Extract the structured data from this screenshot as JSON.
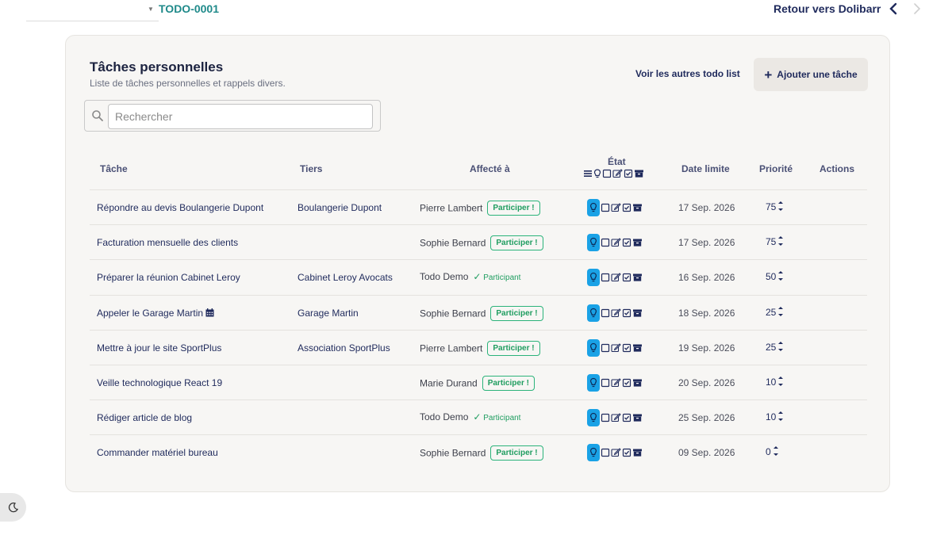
{
  "topbar": {
    "ref": "TODO-0001",
    "back_label": "Retour vers Dolibarr",
    "prev_icon": "chevron-left-icon",
    "next_icon": "chevron-right-icon"
  },
  "header": {
    "title": "Tâches personnelles",
    "subtitle": "Liste de tâches personnelles et rappels divers.",
    "other_lists": "Voir les autres todo list",
    "add_task": "Ajouter une tâche"
  },
  "search": {
    "placeholder": "Rechercher"
  },
  "table": {
    "columns": {
      "task": "Tâche",
      "tiers": "Tiers",
      "assigned": "Affecté à",
      "state": "État",
      "due": "Date limite",
      "priority": "Priorité",
      "actions": "Actions"
    },
    "state_filter_icons": [
      "list-icon",
      "lightbulb-icon",
      "square-icon",
      "edit-icon",
      "check-square-icon",
      "archive-icon"
    ],
    "rows": [
      {
        "task": "Répondre au devis Boulangerie Dupont",
        "tiers": "Boulangerie Dupont",
        "assigned": "Pierre Lambert",
        "badge": "Participer !",
        "participant": "",
        "due": "17 Sep. 2026",
        "priority": "75",
        "calendar_icon": false
      },
      {
        "task": "Facturation mensuelle des clients",
        "tiers": "",
        "assigned": "Sophie Bernard",
        "badge": "Participer !",
        "participant": "",
        "due": "17 Sep. 2026",
        "priority": "75",
        "calendar_icon": false
      },
      {
        "task": "Préparer la réunion Cabinet Leroy",
        "tiers": "Cabinet Leroy Avocats",
        "assigned": "Todo Demo",
        "badge": "",
        "participant": "Participant",
        "due": "16 Sep. 2026",
        "priority": "50",
        "calendar_icon": false
      },
      {
        "task": "Appeler le Garage Martin",
        "tiers": "Garage Martin",
        "assigned": "Sophie Bernard",
        "badge": "Participer !",
        "participant": "",
        "due": "18 Sep. 2026",
        "priority": "25",
        "calendar_icon": true
      },
      {
        "task": "Mettre à jour le site SportPlus",
        "tiers": "Association SportPlus",
        "assigned": "Pierre Lambert",
        "badge": "Participer !",
        "participant": "",
        "due": "19 Sep. 2026",
        "priority": "25",
        "calendar_icon": false
      },
      {
        "task": "Veille technologique React 19",
        "tiers": "",
        "assigned": "Marie Durand",
        "badge": "Participer !",
        "participant": "",
        "due": "20 Sep. 2026",
        "priority": "10",
        "calendar_icon": false
      },
      {
        "task": "Rédiger article de blog",
        "tiers": "",
        "assigned": "Todo Demo",
        "badge": "",
        "participant": "Participant",
        "due": "25 Sep. 2026",
        "priority": "10",
        "calendar_icon": false
      },
      {
        "task": "Commander matériel bureau",
        "tiers": "",
        "assigned": "Sophie Bernard",
        "badge": "Participer !",
        "participant": "",
        "due": "09 Sep. 2026",
        "priority": "0",
        "calendar_icon": false
      }
    ]
  },
  "colors": {
    "navy": "#1f2a5c",
    "teal_ref": "#1f8a8a",
    "green": "#1f9d60",
    "active_state": "#1aa2e6",
    "card_bg": "#f7f6f4"
  },
  "darkmode_icon": "moon-icon"
}
